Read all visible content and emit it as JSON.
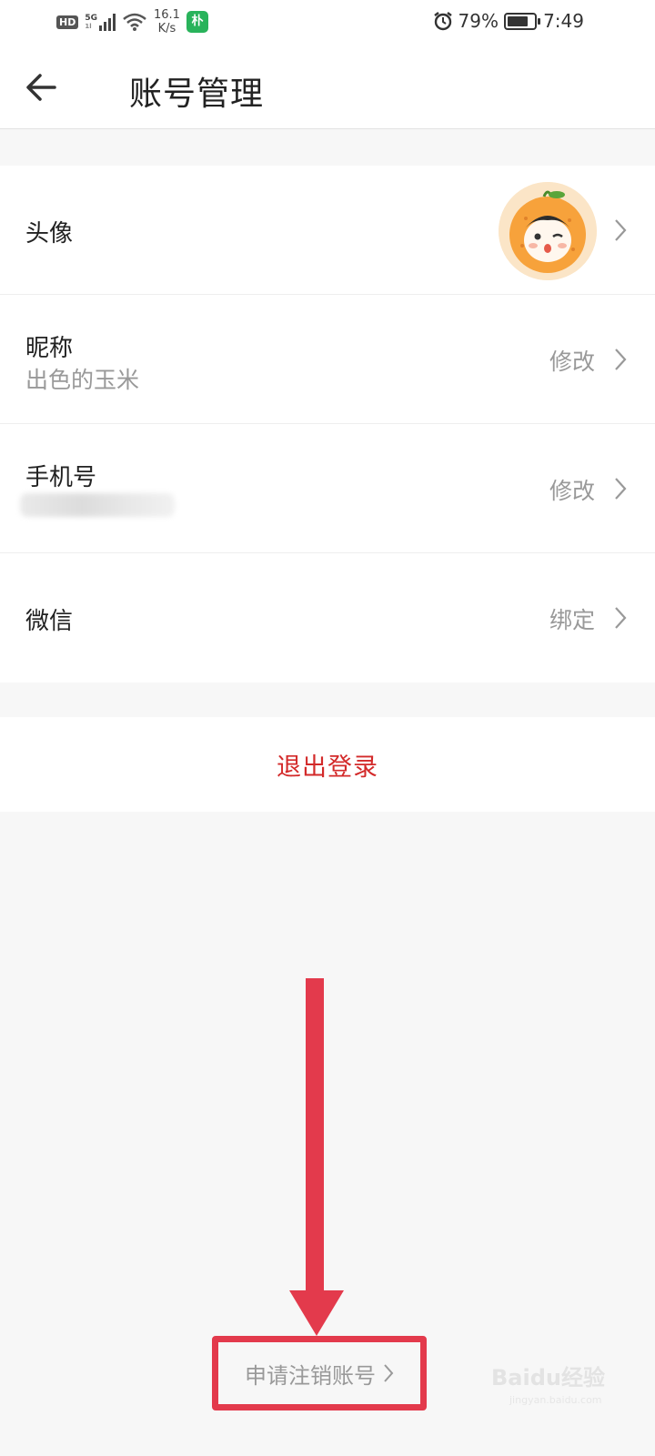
{
  "status_bar": {
    "hd": "HD",
    "network": "5G",
    "net_sub": "1l",
    "speed_value": "16.1",
    "speed_unit": "K/s",
    "app_icon_char": "朴",
    "battery_percent": "79%",
    "battery_level": 0.79,
    "time": "7:49"
  },
  "header": {
    "title": "账号管理"
  },
  "rows": {
    "avatar": {
      "label": "头像"
    },
    "nickname": {
      "label": "昵称",
      "value": "出色的玉米",
      "action": "修改"
    },
    "phone": {
      "label": "手机号",
      "action": "修改"
    },
    "wechat": {
      "label": "微信",
      "action": "绑定"
    }
  },
  "logout": {
    "label": "退出登录"
  },
  "deregister": {
    "label": "申请注销账号"
  },
  "watermark": {
    "text": "Baidu经验",
    "url": "jingyan.baidu.com"
  },
  "colors": {
    "accent_red": "#d32a2a",
    "annotation_red": "#e33a4c",
    "background": "#f7f7f7"
  }
}
